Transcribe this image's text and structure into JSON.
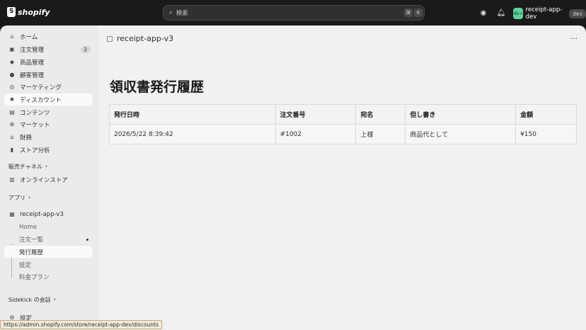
{
  "topbar": {
    "brand": "shopify",
    "search_placeholder": "検索",
    "kbd_cmd": "⌘",
    "kbd_k": "K",
    "store_avatar": "9b-c",
    "store_name": "receipt-app-dev",
    "store_tag": "dev"
  },
  "sidebar": {
    "items": [
      {
        "label": "ホーム",
        "icon": "home-icon"
      },
      {
        "label": "注文管理",
        "icon": "inbox-icon",
        "badge": "2"
      },
      {
        "label": "商品管理",
        "icon": "tag-icon"
      },
      {
        "label": "顧客管理",
        "icon": "person-icon"
      },
      {
        "label": "マーケティング",
        "icon": "target-icon"
      },
      {
        "label": "ディスカウント",
        "icon": "discount-icon"
      },
      {
        "label": "コンテンツ",
        "icon": "content-icon"
      },
      {
        "label": "マーケット",
        "icon": "globe-icon"
      },
      {
        "label": "財務",
        "icon": "bank-icon"
      },
      {
        "label": "ストア分析",
        "icon": "chart-icon"
      }
    ],
    "sales_channels_label": "販売チャネル",
    "online_store": "オンラインストア",
    "apps_label": "アプリ",
    "app_name": "receipt-app-v3",
    "app_subitems": [
      "Home",
      "注文一覧",
      "発行履歴",
      "設定",
      "料金プラン"
    ],
    "sidekick_label": "Sidekick の会話",
    "settings": "設定"
  },
  "main": {
    "app_title": "receipt-app-v3",
    "more": "···",
    "page_title": "領収書発行履歴",
    "table": {
      "headers": [
        "発行日時",
        "注文番号",
        "宛名",
        "但し書き",
        "金額"
      ],
      "rows": [
        [
          "2026/5/22 8:39:42",
          "#1002",
          "上様",
          "商品代として",
          "¥150"
        ]
      ]
    }
  },
  "status_url": "https://admin.shopify.com/store/receipt-app-dev/discounts"
}
